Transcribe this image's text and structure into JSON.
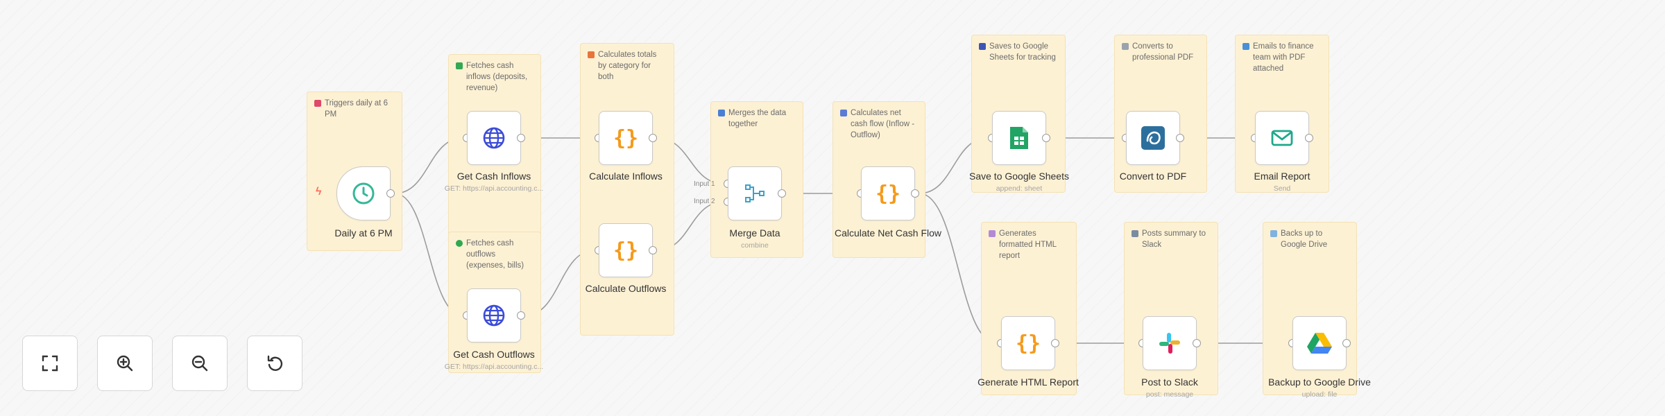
{
  "colors": {
    "canvas": "#f7f7f7",
    "sticky": "#fdf1d4",
    "edge": "#9c9c9c",
    "code": "#f59a1b",
    "http": "#3b4bd8",
    "trigger": "#35b79a"
  },
  "notes": [
    {
      "id": "trigger",
      "text": "Triggers daily at 6 PM",
      "icon": "alarm-icon",
      "color": "#e0476a"
    },
    {
      "id": "inflows",
      "text": "Fetches cash inflows (deposits, revenue)",
      "icon": "green-square-icon",
      "color": "#34a853"
    },
    {
      "id": "calculates",
      "text": "Calculates totals by category for both",
      "icon": "chart-icon",
      "color": "#e8743b"
    },
    {
      "id": "outflows",
      "text": "Fetches cash outflows (expenses, bills)",
      "icon": "green-dot-icon",
      "color": "#2fa84f"
    },
    {
      "id": "merge",
      "text": "Merges the data together",
      "icon": "blue-square-icon",
      "color": "#4a7fd6"
    },
    {
      "id": "net",
      "text": "Calculates net cash flow (Inflow - Outflow)",
      "icon": "clipboard-icon",
      "color": "#5b7bd5"
    },
    {
      "id": "sheets",
      "text": "Saves to Google Sheets for tracking",
      "icon": "disk-icon",
      "color": "#3d56b5"
    },
    {
      "id": "pdf",
      "text": "Converts to professional PDF",
      "icon": "document-icon",
      "color": "#9aa3ad"
    },
    {
      "id": "email",
      "text": "Emails to finance team with PDF attached",
      "icon": "envelope-icon",
      "color": "#4a90d6"
    },
    {
      "id": "html",
      "text": "Generates formatted HTML report",
      "icon": "page-icon",
      "color": "#b48ad6"
    },
    {
      "id": "slack",
      "text": "Posts summary to Slack",
      "icon": "chat-icon",
      "color": "#7b8ba0"
    },
    {
      "id": "drive",
      "text": "Backs up to Google Drive",
      "icon": "cloud-icon",
      "color": "#7fb2e0"
    }
  ],
  "nodes": [
    {
      "id": "daily",
      "label": "Daily at 6 PM",
      "subtitle": "",
      "icon": "clock-icon"
    },
    {
      "id": "inflows",
      "label": "Get Cash Inflows",
      "subtitle": "GET: https://api.accounting.c...",
      "icon": "globe-icon"
    },
    {
      "id": "outflows",
      "label": "Get Cash Outflows",
      "subtitle": "GET: https://api.accounting.c...",
      "icon": "globe-icon"
    },
    {
      "id": "calc_in",
      "label": "Calculate Inflows",
      "subtitle": "",
      "icon": "code-icon"
    },
    {
      "id": "calc_out",
      "label": "Calculate Outflows",
      "subtitle": "",
      "icon": "code-icon"
    },
    {
      "id": "merge",
      "label": "Merge Data",
      "subtitle": "combine",
      "icon": "merge-icon",
      "inputs": [
        "Input 1",
        "Input 2"
      ]
    },
    {
      "id": "net",
      "label": "Calculate Net Cash Flow",
      "subtitle": "",
      "icon": "code-icon"
    },
    {
      "id": "sheets",
      "label": "Save to Google Sheets",
      "subtitle": "append: sheet",
      "icon": "google-sheets-icon"
    },
    {
      "id": "pdf",
      "label": "Convert to PDF",
      "subtitle": "",
      "icon": "pdf-service-icon"
    },
    {
      "id": "email",
      "label": "Email Report",
      "subtitle": "Send",
      "icon": "mail-icon"
    },
    {
      "id": "html",
      "label": "Generate HTML Report",
      "subtitle": "",
      "icon": "code-icon"
    },
    {
      "id": "slack",
      "label": "Post to Slack",
      "subtitle": "post: message",
      "icon": "slack-icon"
    },
    {
      "id": "drive",
      "label": "Backup to Google Drive",
      "subtitle": "upload: file",
      "icon": "google-drive-icon"
    }
  ],
  "controls": [
    {
      "id": "fit",
      "icon": "fit-view-icon"
    },
    {
      "id": "zoom_in",
      "icon": "zoom-in-icon"
    },
    {
      "id": "zoom_out",
      "icon": "zoom-out-icon"
    },
    {
      "id": "reset",
      "icon": "reset-zoom-icon"
    }
  ]
}
